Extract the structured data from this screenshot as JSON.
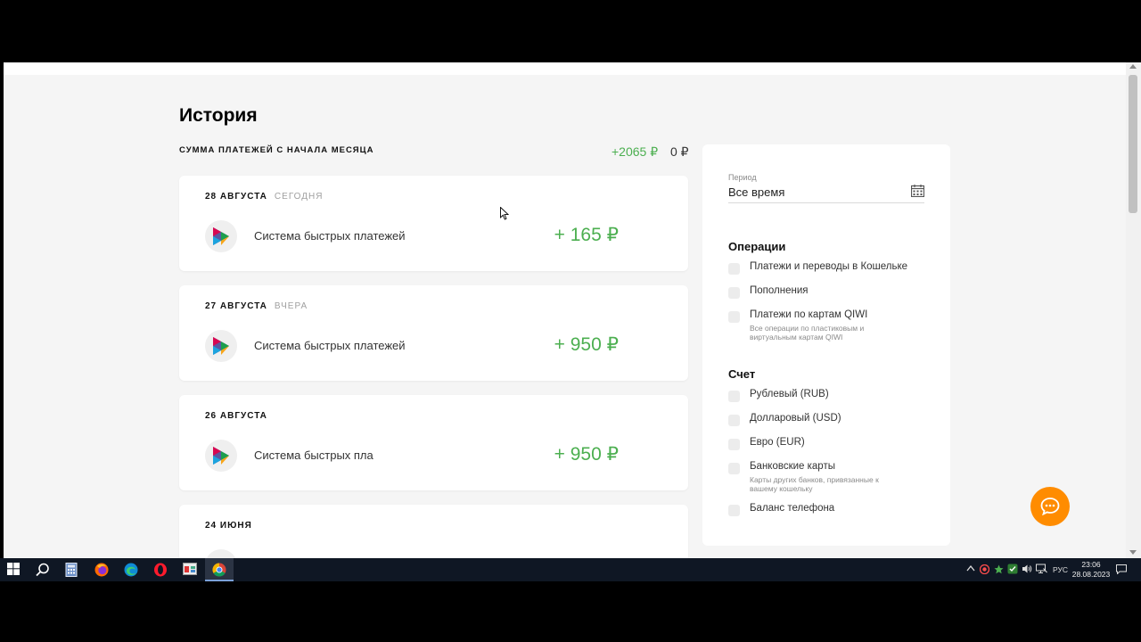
{
  "page": {
    "title": "История",
    "sum_label": "СУММА ПЛАТЕЖЕЙ С НАЧАЛА МЕСЯЦА",
    "sum_income": "+2065 ₽",
    "sum_expense": "0 ₽"
  },
  "history": [
    {
      "date": "28 АВГУСТА",
      "relative": "СЕГОДНЯ",
      "operation": "Система быстрых платежей",
      "amount": "+ 165 ₽"
    },
    {
      "date": "27 АВГУСТА",
      "relative": "ВЧЕРА",
      "operation": "Система быстрых платежей",
      "amount": "+ 950 ₽"
    },
    {
      "date": "26 АВГУСТА",
      "relative": "",
      "operation": "Система быстрых пла",
      "amount": "+ 950 ₽"
    },
    {
      "date": "24 ИЮНЯ",
      "relative": ""
    }
  ],
  "filter": {
    "period_label": "Период",
    "period_value": "Все время",
    "operations_title": "Операции",
    "operations": [
      {
        "label": "Платежи и переводы в Кошельке",
        "sub": ""
      },
      {
        "label": "Пополнения",
        "sub": ""
      },
      {
        "label": "Платежи по картам QIWI",
        "sub": "Все операции по пластиковым и виртуальным картам QIWI"
      }
    ],
    "account_title": "Счет",
    "accounts": [
      {
        "label": "Рублевый (RUB)",
        "sub": ""
      },
      {
        "label": "Долларовый (USD)",
        "sub": ""
      },
      {
        "label": "Евро (EUR)",
        "sub": ""
      },
      {
        "label": "Банковские карты",
        "sub": "Карты других банков, привязанные к вашему кошельку"
      },
      {
        "label": "Баланс телефона",
        "sub": ""
      }
    ]
  },
  "taskbar": {
    "language": "РУС",
    "time": "23:06",
    "date": "28.08.2023"
  },
  "colors": {
    "income": "#4caf50",
    "accent": "#ff8c00",
    "background": "#f5f5f5"
  }
}
